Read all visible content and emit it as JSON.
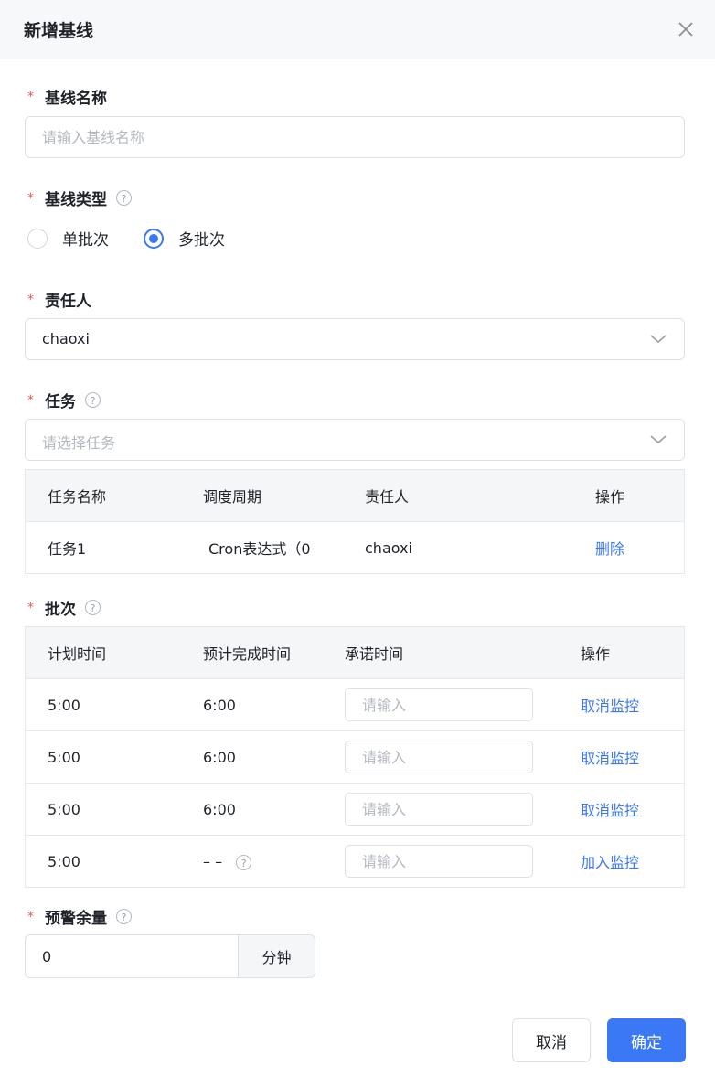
{
  "dialog": {
    "title": "新增基线"
  },
  "baseline_name": {
    "label": "基线名称",
    "required": "*",
    "placeholder": "请输入基线名称",
    "value": ""
  },
  "baseline_type": {
    "label": "基线类型",
    "required": "*",
    "help": "?",
    "options": [
      "单批次",
      "多批次"
    ],
    "selected": "多批次"
  },
  "owner": {
    "label": "责任人",
    "required": "*",
    "value": "chaoxi"
  },
  "task": {
    "label": "任务",
    "required": "*",
    "help": "?",
    "placeholder": "请选择任务",
    "columns": [
      "任务名称",
      "调度周期",
      "责任人",
      "操作"
    ],
    "rows": [
      {
        "name": "任务1",
        "cycle": "Cron表达式（0",
        "owner": "chaoxi",
        "action": "删除"
      }
    ]
  },
  "batch": {
    "label": "批次",
    "required": "*",
    "help": "?",
    "columns": [
      "计划时间",
      "预计完成时间",
      "承诺时间",
      "操作"
    ],
    "input_placeholder": "请输入",
    "rows": [
      {
        "plan": "5:00",
        "finish": "6:00",
        "action": "取消监控"
      },
      {
        "plan": "5:00",
        "finish": "6:00",
        "action": "取消监控"
      },
      {
        "plan": "5:00",
        "finish": "6:00",
        "action": "取消监控"
      },
      {
        "plan": "5:00",
        "finish": "– –",
        "action": "加入监控"
      }
    ]
  },
  "warning": {
    "label": "预警余量",
    "required": "*",
    "help": "?",
    "value": "0",
    "unit": "分钟"
  },
  "footer": {
    "cancel": "取消",
    "confirm": "确定"
  },
  "colors": {
    "primary": "#3b78f5",
    "required": "#f05a4a"
  }
}
